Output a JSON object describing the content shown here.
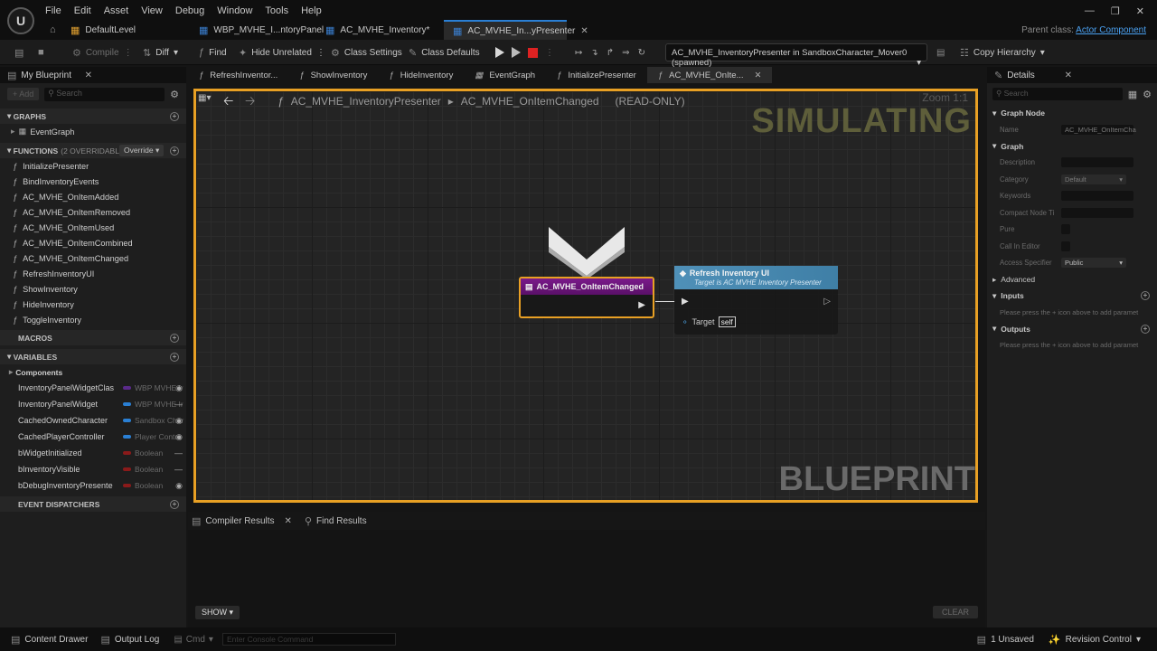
{
  "topbar": {
    "menu": [
      "File",
      "Edit",
      "Asset",
      "View",
      "Debug",
      "Window",
      "Tools",
      "Help"
    ],
    "tabs": [
      "DefaultLevel",
      "WBP_MVHE_I...ntoryPanel",
      "AC_MVHE_Inventory*",
      "AC_MVHE_In...yPresenter"
    ],
    "parent_label": "Parent class:",
    "parent_value": "Actor Component"
  },
  "toolbar": {
    "compile": "Compile",
    "diff": "Diff",
    "find": "Find",
    "hide_unrelated": "Hide Unrelated",
    "class_settings": "Class Settings",
    "class_defaults": "Class Defaults",
    "debug_object": "AC_MVHE_InventoryPresenter in SandboxCharacter_Mover0 (spawned)",
    "copy_hierarchy": "Copy Hierarchy"
  },
  "left": {
    "title": "My Blueprint",
    "add": "Add",
    "search_placeholder": "Search",
    "graphs_header": "GRAPHS",
    "graphs": [
      "EventGraph"
    ],
    "functions_header": "FUNCTIONS",
    "functions_count": "(2 OVERRIDABLE)",
    "override": "Override",
    "functions": [
      "InitializePresenter",
      "BindInventoryEvents",
      "AC_MVHE_OnItemAdded",
      "AC_MVHE_OnItemRemoved",
      "AC_MVHE_OnItemUsed",
      "AC_MVHE_OnItemCombined",
      "AC_MVHE_OnItemChanged",
      "RefreshInventoryUI",
      "ShowInventory",
      "HideInventory",
      "ToggleInventory"
    ],
    "macros_header": "MACROS",
    "variables_header": "VARIABLES",
    "components": "Components",
    "variables": [
      {
        "name": "InventoryPanelWidgetClas",
        "type": "WBP MVHE Ir",
        "color": "#5a2a8a",
        "vis": "eye"
      },
      {
        "name": "InventoryPanelWidget",
        "type": "WBP MVHE Ir",
        "color": "#2a7fd4",
        "vis": "closed"
      },
      {
        "name": "CachedOwnedCharacter",
        "type": "Sandbox Char",
        "color": "#2a7fd4",
        "vis": "eye"
      },
      {
        "name": "CachedPlayerController",
        "type": "Player Contro",
        "color": "#2a7fd4",
        "vis": "eye"
      },
      {
        "name": "bWidgetInitialized",
        "type": "Boolean",
        "color": "#8a1a1a",
        "vis": "closed"
      },
      {
        "name": "bInventoryVisible",
        "type": "Boolean",
        "color": "#8a1a1a",
        "vis": "closed"
      },
      {
        "name": "bDebugInventoryPresente",
        "type": "Boolean",
        "color": "#8a1a1a",
        "vis": "eye"
      }
    ],
    "dispatchers_header": "EVENT DISPATCHERS"
  },
  "graph": {
    "tabs": [
      "RefreshInventor...",
      "ShowInventory",
      "HideInventory",
      "EventGraph",
      "InitializePresenter",
      "AC_MVHE_OnIte..."
    ],
    "breadcrumb_root": "AC_MVHE_InventoryPresenter",
    "breadcrumb_current": "AC_MVHE_OnItemChanged",
    "readonly": "(READ-ONLY)",
    "zoom": "Zoom 1:1",
    "simulating": "SIMULATING",
    "blueprint": "BLUEPRINT",
    "node_entry": "AC_MVHE_OnItemChanged",
    "node_call_title": "Refresh Inventory UI",
    "node_call_sub": "Target is AC MVHE Inventory Presenter",
    "pin_target": "Target",
    "pin_self": "self"
  },
  "bottom": {
    "tab_compiler": "Compiler Results",
    "tab_find": "Find Results",
    "show": "SHOW",
    "clear": "CLEAR"
  },
  "details": {
    "title": "Details",
    "search_placeholder": "Search",
    "graph_node": "Graph Node",
    "name_label": "Name",
    "name_value": "AC_MVHE_OnItemCha",
    "graph": "Graph",
    "description": "Description",
    "category": "Category",
    "category_value": "Default",
    "keywords": "Keywords",
    "compact": "Compact Node Ti",
    "pure": "Pure",
    "call_in_editor": "Call In Editor",
    "access": "Access Specifier",
    "access_value": "Public",
    "advanced": "Advanced",
    "inputs": "Inputs",
    "inputs_hint": "Please press the + icon above to add paramet",
    "outputs": "Outputs",
    "outputs_hint": "Please press the + icon above to add paramet"
  },
  "status": {
    "content_drawer": "Content Drawer",
    "output_log": "Output Log",
    "cmd": "Cmd",
    "console_placeholder": "Enter Console Command",
    "unsaved": "1 Unsaved",
    "revision": "Revision Control"
  }
}
